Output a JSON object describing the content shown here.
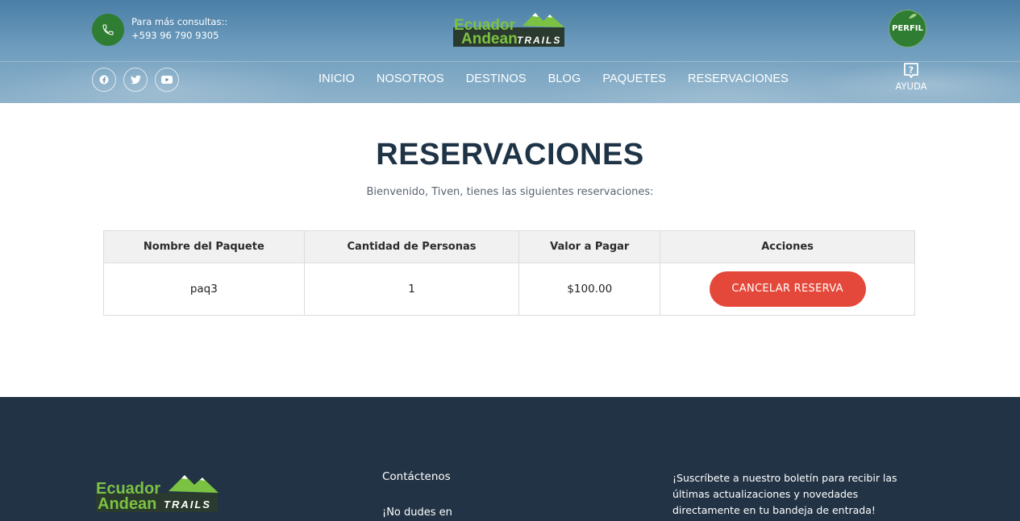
{
  "header": {
    "contact_label": "Para más consultas::",
    "phone": "+593 96 790 9305",
    "logo_line1": "Ecuador",
    "logo_line2": "Andean",
    "logo_trails": "TRAILS",
    "profile_label": "PERFIL",
    "help_label": "AYUDA",
    "social_icons": [
      "facebook-icon",
      "twitter-icon",
      "youtube-icon"
    ],
    "nav": [
      {
        "label": "INICIO"
      },
      {
        "label": "NOSOTROS"
      },
      {
        "label": "DESTINOS"
      },
      {
        "label": "BLOG"
      },
      {
        "label": "PAQUETES"
      },
      {
        "label": "RESERVACIONES"
      }
    ]
  },
  "main": {
    "title": "RESERVACIONES",
    "welcome": "Bienvenido, Tiven, tienes las siguientes reservaciones:",
    "table": {
      "headers": [
        "Nombre del Paquete",
        "Cantidad de Personas",
        "Valor a Pagar",
        "Acciones"
      ],
      "rows": [
        {
          "package": "paq3",
          "people": "1",
          "amount": "$100.00",
          "action_label": "CANCELAR RESERVA"
        }
      ]
    }
  },
  "footer": {
    "logo_line1": "Ecuador",
    "logo_line2": "Andean",
    "logo_trails": "TRAILS",
    "contact_heading": "Contáctenos",
    "contact_text": "¡No dudes en",
    "newsletter": "¡Suscríbete a nuestro boletín para recibir las últimas actualizaciones y novedades directamente en tu bandeja de entrada!"
  },
  "colors": {
    "brand_green": "#2f7d32",
    "logo_green": "#7cc242",
    "title_navy": "#1f3347",
    "cancel_red": "#e4483a",
    "footer_bg": "#223345"
  }
}
